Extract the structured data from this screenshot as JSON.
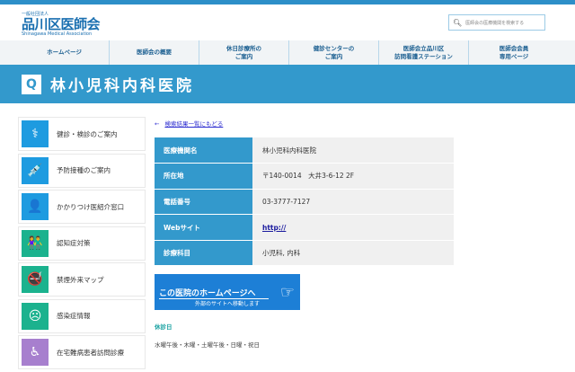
{
  "header": {
    "org_small": "一般社団法人",
    "org_name": "品川区医師会",
    "org_en": "Shinagawa Medical Association",
    "search_placeholder": "医師会の医療機関を検索する"
  },
  "nav": [
    "ホームページ",
    "医師会の概要",
    "休日診療所の\nご案内",
    "健診センターの\nご案内",
    "医師会立品川区\n訪問看護ステーション",
    "医師会会員\n専用ページ"
  ],
  "page_title": "林小児科内科医院",
  "sidebar": [
    {
      "label": "健診・検診のご案内",
      "icon": "stethoscope-icon",
      "color": "#1e9be0",
      "glyph": "⚕"
    },
    {
      "label": "予防接種のご案内",
      "icon": "syringe-icon",
      "color": "#1e9be0",
      "glyph": "💉"
    },
    {
      "label": "かかりつけ医紹介窓口",
      "icon": "doctor-icon",
      "color": "#1e9be0",
      "glyph": "👤"
    },
    {
      "label": "認知症対策",
      "icon": "elderly-couple-icon",
      "color": "#1bb28e",
      "glyph": "👫"
    },
    {
      "label": "禁煙外来マップ",
      "icon": "no-smoking-icon",
      "color": "#1bb28e",
      "glyph": "🚭"
    },
    {
      "label": "感染症情報",
      "icon": "sick-face-icon",
      "color": "#1bb28e",
      "glyph": "☹"
    },
    {
      "label": "在宅難病患者訪問診療",
      "icon": "home-care-icon",
      "color": "#a77fce",
      "glyph": "♿"
    }
  ],
  "back_link": "検索結果一覧にもどる",
  "details": [
    {
      "label": "医療機関名",
      "value": "林小児科内科医院"
    },
    {
      "label": "所在地",
      "value": "〒140-0014　大井3-6-12 2F"
    },
    {
      "label": "電話番号",
      "value": "03-3777-7127"
    },
    {
      "label": "Webサイト",
      "value": "http://"
    },
    {
      "label": "診療科目",
      "value": "小児科, 内科"
    }
  ],
  "homepage_button": {
    "title": "この医院のホームページへ",
    "sub": "外部のサイトへ移動します"
  },
  "closed_days": {
    "heading": "休診日",
    "value": "水曜午後・木曜・土曜午後・日曜・祝日"
  }
}
